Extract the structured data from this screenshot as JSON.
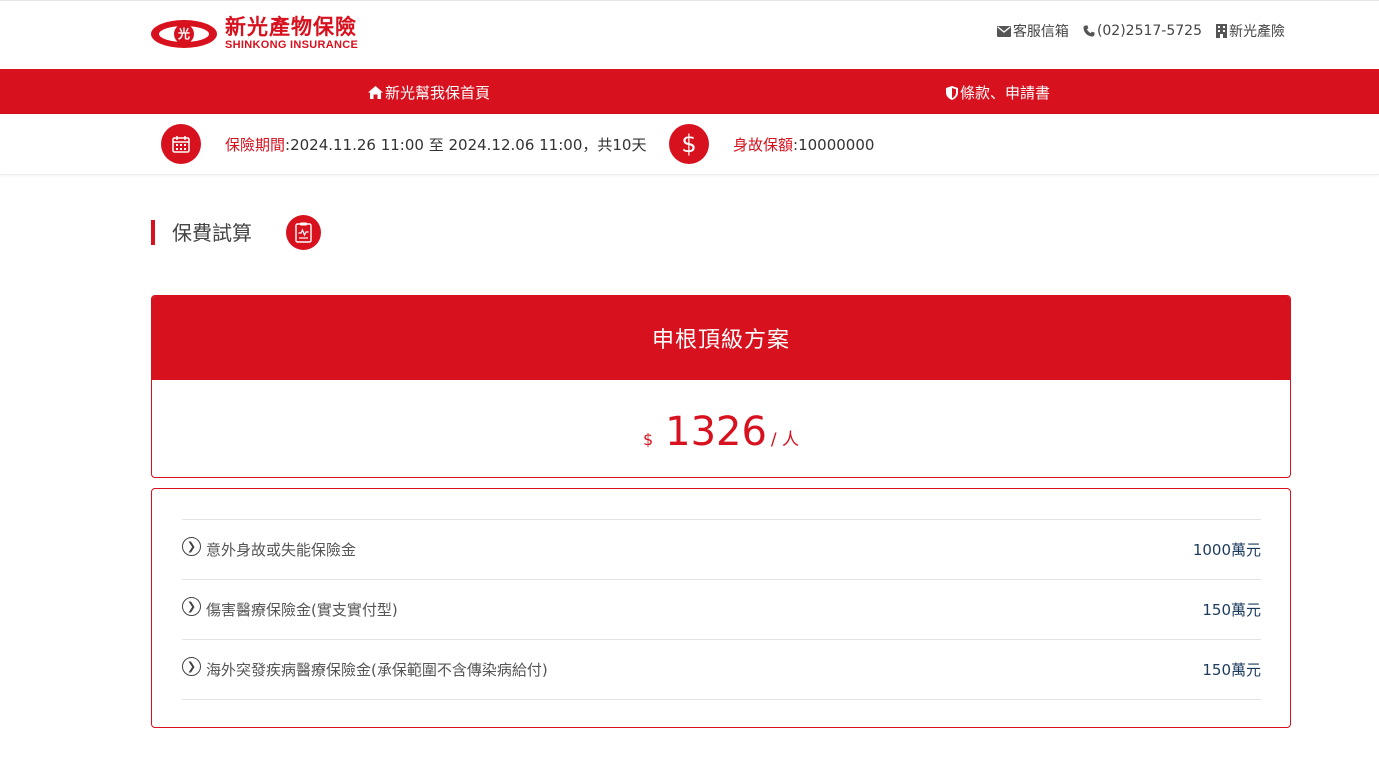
{
  "header": {
    "logo_cn": "新光產物保險",
    "logo_en": "SHINKONG INSURANCE",
    "logo_mark": "光",
    "links": [
      {
        "icon": "envelope-icon",
        "label": "客服信箱"
      },
      {
        "icon": "phone-icon",
        "label": "(02)2517-5725"
      },
      {
        "icon": "building-icon",
        "label": "新光產險"
      }
    ]
  },
  "nav": {
    "home_label": "新光幫我保首頁",
    "terms_label": "條款、申請書"
  },
  "info": {
    "period_label": "保險期間",
    "period_value": ":2024.11.26 11:00 至 2024.12.06 11:00，共10天",
    "amount_label": "身故保額",
    "amount_value": ":10000000",
    "dollar_glyph": "$"
  },
  "section": {
    "title": "保費試算"
  },
  "plan": {
    "name": "申根頂級方案",
    "currency": "$",
    "price": "1326",
    "unit": "/ 人"
  },
  "coverages": [
    {
      "label": "意外身故或失能保險金",
      "value": "1000萬元"
    },
    {
      "label": "傷害醫療保險金(實支實付型)",
      "value": "150萬元"
    },
    {
      "label": "海外突發疾病醫療保險金(承保範圍不含傳染病給付)",
      "value": "150萬元"
    }
  ],
  "colors": {
    "brand_red": "#d7111e",
    "value_navy": "#1b3a5c"
  }
}
